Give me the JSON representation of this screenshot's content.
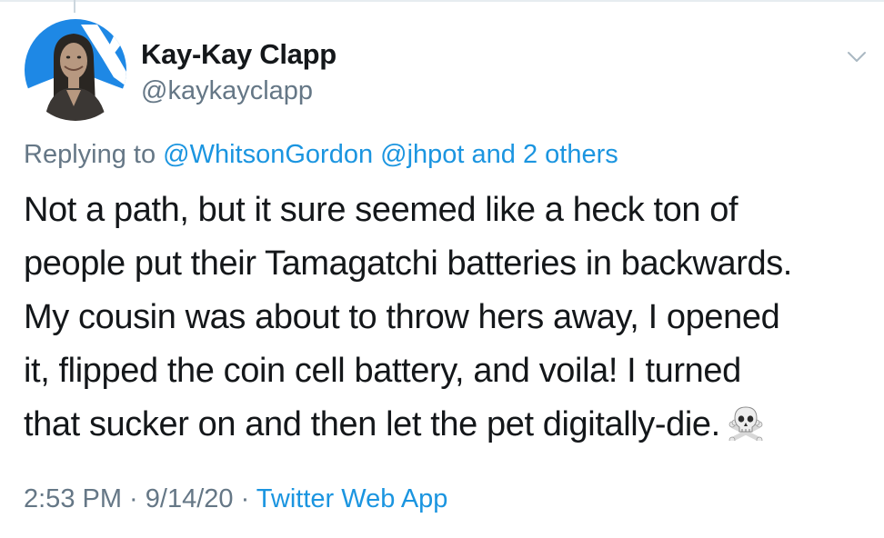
{
  "tweet": {
    "author": {
      "display_name": "Kay-Kay Clapp",
      "handle": "@kaykayclapp",
      "avatar_icon": "profile-photo-woman"
    },
    "menu_icon": "chevron-down-icon",
    "replying": {
      "prefix": "Replying to",
      "mention_1": "@WhitsonGordon",
      "mention_2": "@jhpot",
      "others": "and 2 others"
    },
    "body_lines": [
      "Not a path, but it sure seemed like a heck ton of",
      "people put their Tamagatchi batteries in backwards.",
      "My cousin was about to throw hers away, I opened",
      "it, flipped the coin cell battery, and voila! I turned",
      "that sucker on and then let the pet digitally-die."
    ],
    "emoji_icon": "skull-and-crossbones-icon",
    "meta": {
      "time": "2:53 PM",
      "separator_1": " · ",
      "date": "9/14/20",
      "separator_2": " · ",
      "source": "Twitter Web App"
    }
  },
  "colors": {
    "text_primary": "#14171a",
    "text_secondary": "#657786",
    "link": "#1b95e0",
    "avatar_accent": "#1e88e5",
    "divider": "#e6ecf0"
  }
}
